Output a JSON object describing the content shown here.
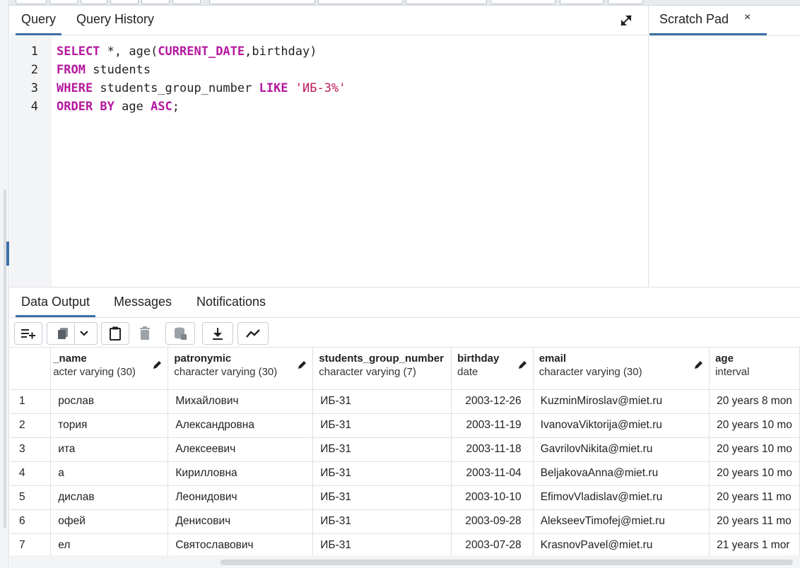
{
  "query_panel": {
    "tabs": [
      {
        "label": "Query",
        "active": true
      },
      {
        "label": "Query History",
        "active": false
      }
    ],
    "expand_icon": "expand-diagonal-icon",
    "code_lines": [
      {
        "num": "1"
      },
      {
        "num": "2"
      },
      {
        "num": "3"
      },
      {
        "num": "4"
      }
    ],
    "tokens": {
      "l1_select": "SELECT",
      "l1_rest_a": " *, age(",
      "l1_current_date": "CURRENT_DATE",
      "l1_rest_b": ",birthday)",
      "l2_from": "FROM",
      "l2_rest": " students",
      "l3_where": "WHERE",
      "l3_mid": " students_group_number ",
      "l3_like": "LIKE",
      "l3_space": " ",
      "l3_str": "'ИБ-3%'",
      "l4_order": "ORDER BY",
      "l4_mid": " age ",
      "l4_asc": "ASC",
      "l4_end": ";"
    }
  },
  "scratch_pad": {
    "label": "Scratch Pad",
    "close_label": "×"
  },
  "output_panel": {
    "tabs": [
      {
        "label": "Data Output",
        "active": true
      },
      {
        "label": "Messages",
        "active": false
      },
      {
        "label": "Notifications",
        "active": false
      }
    ],
    "toolbar_icons": [
      "add-row-icon",
      "copy-icon",
      "chevron-down-icon",
      "paste-icon",
      "delete-icon",
      "save-data-icon",
      "download-icon",
      "graph-icon"
    ],
    "columns": [
      {
        "name": "_name",
        "type": "acter varying (30)",
        "editable": true
      },
      {
        "name": "patronymic",
        "type": "character varying (30)",
        "editable": true
      },
      {
        "name": "students_group_number",
        "type": "character varying (7)",
        "editable": false
      },
      {
        "name": "birthday",
        "type": "date",
        "editable": true
      },
      {
        "name": "email",
        "type": "character varying (30)",
        "editable": true
      },
      {
        "name": "age",
        "type": "interval",
        "editable": false
      }
    ],
    "rows": [
      {
        "n": "1",
        "name": "рослав",
        "patronymic": "Михайлович",
        "group": "ИБ-31",
        "birthday": "2003-12-26",
        "email": "KuzminMiroslav@miet.ru",
        "age": "20 years 8 mon"
      },
      {
        "n": "2",
        "name": "тория",
        "patronymic": "Александровна",
        "group": "ИБ-31",
        "birthday": "2003-11-19",
        "email": "IvanovaViktorija@miet.ru",
        "age": "20 years 10 mo"
      },
      {
        "n": "3",
        "name": "ита",
        "patronymic": "Алексеевич",
        "group": "ИБ-31",
        "birthday": "2003-11-18",
        "email": "GavrilovNikita@miet.ru",
        "age": "20 years 10 mo"
      },
      {
        "n": "4",
        "name": "а",
        "patronymic": "Кирилловна",
        "group": "ИБ-31",
        "birthday": "2003-11-04",
        "email": "BeljakovaAnna@miet.ru",
        "age": "20 years 10 mo"
      },
      {
        "n": "5",
        "name": "дислав",
        "patronymic": "Леонидович",
        "group": "ИБ-31",
        "birthday": "2003-10-10",
        "email": "EfimovVladislav@miet.ru",
        "age": "20 years 11 mo"
      },
      {
        "n": "6",
        "name": "офей",
        "patronymic": "Денисович",
        "group": "ИБ-31",
        "birthday": "2003-09-28",
        "email": "AlekseevTimofej@miet.ru",
        "age": "20 years 11 mo"
      },
      {
        "n": "7",
        "name": "ел",
        "patronymic": "Святославович",
        "group": "ИБ-31",
        "birthday": "2003-07-28",
        "email": "KrasnovPavel@miet.ru",
        "age": "21 years 1 mor"
      }
    ]
  }
}
